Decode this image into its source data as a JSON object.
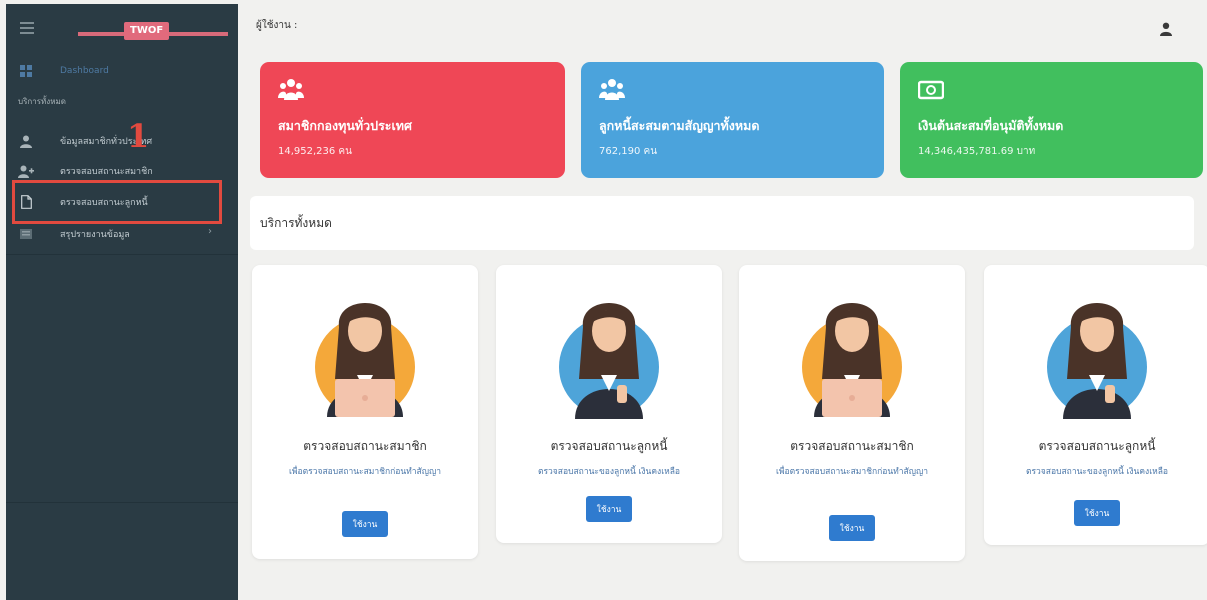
{
  "sidebar": {
    "logo": "TWOF",
    "dashboard": "Dashboard",
    "section_title": "บริการทั้งหมด",
    "items": [
      {
        "label": "ข้อมูลสมาชิกทั่วประเทศ",
        "icon": "user-icon"
      },
      {
        "label": "ตรวจสอบสถานะสมาชิก",
        "icon": "user-plus-icon"
      },
      {
        "label": "ตรวจสอบสถานะลูกหนี้",
        "icon": "file-icon"
      },
      {
        "label": "สรุปรายงานข้อมูล",
        "icon": "chart-icon"
      }
    ],
    "annotation_number": "1"
  },
  "header": {
    "user_label": "ผู้ใช้งาน :"
  },
  "stats": [
    {
      "title": "สมาชิกกองทุนทั่วประเทศ",
      "value": "14,952,236 คน",
      "color": "#ef4756",
      "icon": "users-icon"
    },
    {
      "title": "ลูกหนี้สะสมตามสัญญาทั้งหมด",
      "value": "762,190 คน",
      "color": "#4ba3dc",
      "icon": "users-icon"
    },
    {
      "title": "เงินต้นสะสมที่อนุมัติทั้งหมด",
      "value": "14,346,435,781.69 บาท",
      "color": "#41bf5e",
      "icon": "money-icon"
    }
  ],
  "services": {
    "header": "บริการทั้งหมด",
    "cards": [
      {
        "title": "ตรวจสอบสถานะสมาชิก",
        "desc": "เพื่อตรวจสอบสถานะสมาชิกก่อนทำสัญญา",
        "button": "ใช้งาน",
        "circle_color": "#f4a83a"
      },
      {
        "title": "ตรวจสอบสถานะลูกหนี้",
        "desc": "ตรวจสอบสถานะของลูกหนี้ เงินคงเหลือ",
        "button": "ใช้งาน",
        "circle_color": "#4ea4d9"
      },
      {
        "title": "ตรวจสอบสถานะสมาชิก",
        "desc": "เพื่อตรวจสอบสถานะสมาชิกก่อนทำสัญญา",
        "button": "ใช้งาน",
        "circle_color": "#f4a83a"
      },
      {
        "title": "ตรวจสอบสถานะลูกหนี้",
        "desc": "ตรวจสอบสถานะของลูกหนี้ เงินคงเหลือ",
        "button": "ใช้งาน",
        "circle_color": "#4ea4d9"
      }
    ]
  }
}
